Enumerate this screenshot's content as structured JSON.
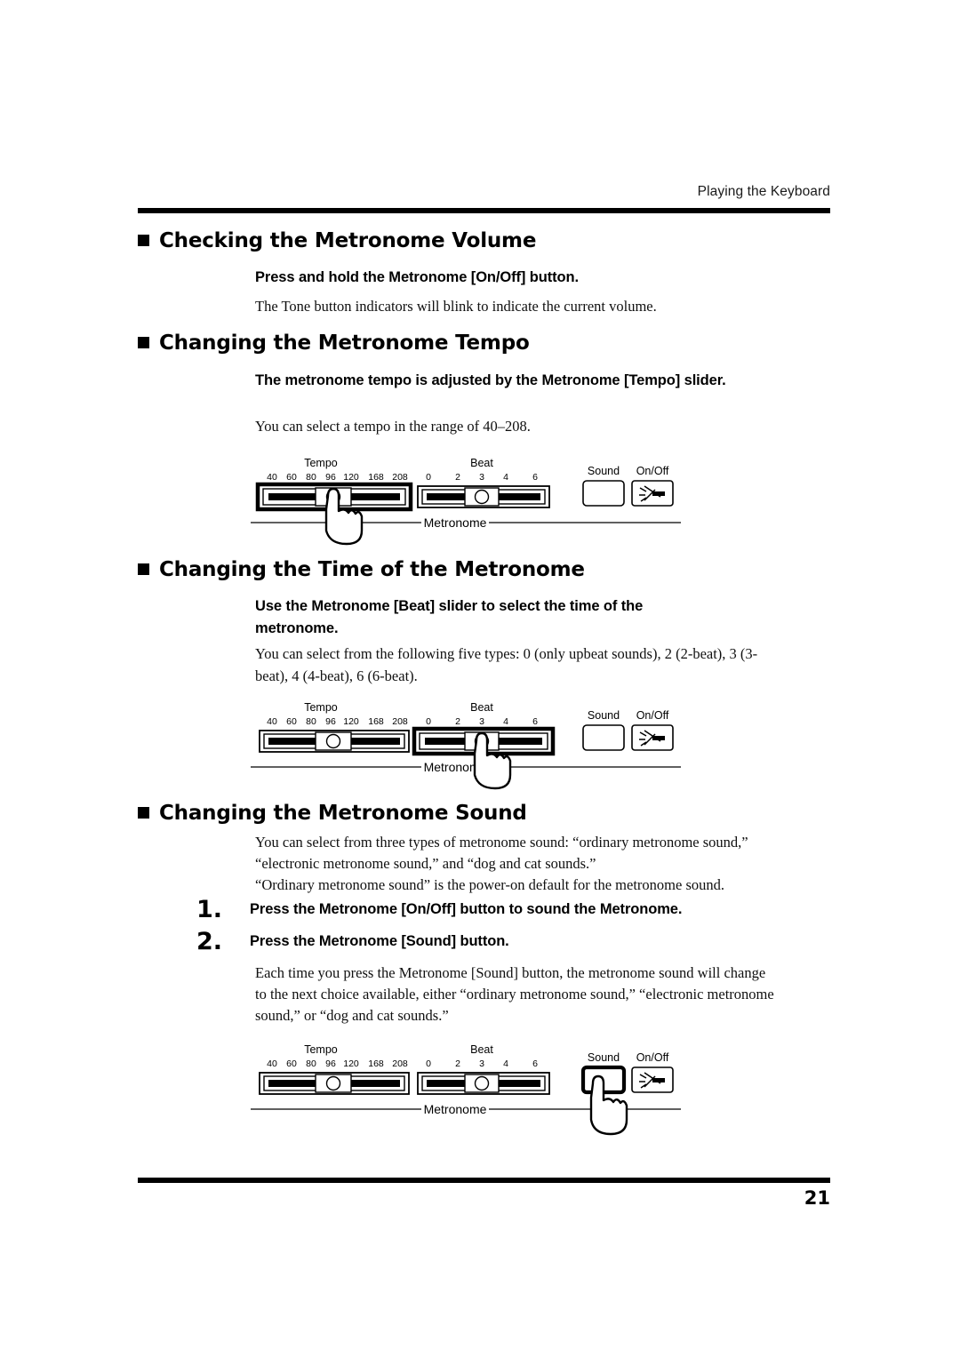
{
  "header": {
    "running_head": "Playing the Keyboard"
  },
  "footer": {
    "page_number": "21"
  },
  "sections": [
    {
      "heading": "Checking the Metronome Volume",
      "lead": "Press and hold the Metronome [On/Off] button.",
      "body": "The Tone button indicators will blink to indicate the current volume."
    },
    {
      "heading": "Changing the Metronome Tempo",
      "lead": "The metronome tempo is adjusted by the Metronome [Tempo] slider.",
      "body": "You can select a tempo in the range of 40–208."
    },
    {
      "heading": "Changing the Time of the Metronome",
      "lead": "Use the Metronome [Beat] slider to select the time of the metronome.",
      "body_line1": "You can select from the following five types: 0 (only upbeat sounds), 2 (2-beat), 3 (3-",
      "body_line2": "beat), 4 (4-beat), 6 (6-beat)."
    },
    {
      "heading": "Changing the Metronome Sound",
      "body_line1": "You can select from three types of metronome sound: “ordinary metronome sound,”",
      "body_line2": "“electronic metronome sound,” and “dog and cat sounds.”",
      "body_line3": "“Ordinary metronome sound” is the power-on default for the metronome sound.",
      "steps": [
        {
          "number": "1.",
          "text": "Press the Metronome [On/Off] button to sound the Metronome."
        },
        {
          "number": "2.",
          "text": "Press the Metronome [Sound] button."
        }
      ],
      "after_steps_line1": "Each time you press the Metronome [Sound] button, the metronome sound will change",
      "after_steps_line2": "to the next choice available, either “ordinary metronome sound,” “electronic metronome",
      "after_steps_line3": "sound,” or “dog and cat sounds.”"
    }
  ],
  "panel": {
    "tempo_label": "Tempo",
    "tempo_ticks": [
      "40",
      "60",
      "80",
      "96",
      "120",
      "168",
      "208"
    ],
    "beat_label": "Beat",
    "beat_ticks": [
      "0",
      "2",
      "3",
      "4",
      "6"
    ],
    "sound_label": "Sound",
    "onoff_label": "On/Off",
    "group_label": "Metronome",
    "onoff_icon": "metronome-blink-icon"
  },
  "diagrams": [
    {
      "id": "tempo-slider-diagram",
      "highlight": "tempo-slider",
      "hand": "tempo-slider"
    },
    {
      "id": "beat-slider-diagram",
      "highlight": "beat-slider",
      "hand": "beat-slider"
    },
    {
      "id": "sound-button-diagram",
      "highlight": "sound-button",
      "hand": "sound-button"
    }
  ],
  "colors": {
    "ink": "#000000",
    "paper": "#ffffff"
  }
}
